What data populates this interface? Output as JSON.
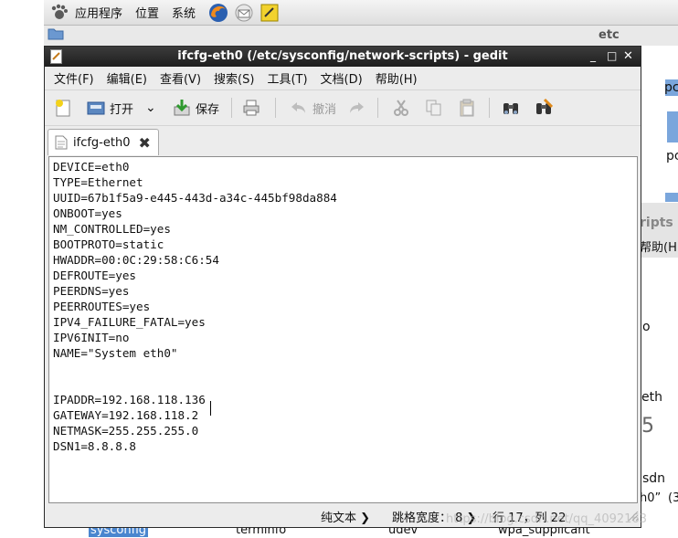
{
  "panel": {
    "menus": [
      "应用程序",
      "位置",
      "系统"
    ],
    "icons": [
      "gnome-foot-icon",
      "firefox-icon",
      "mail-icon",
      "notes-icon"
    ]
  },
  "background_window": {
    "title": "etc",
    "side_labels": [
      "pc",
      "pc",
      "ripts",
      "帮助(H",
      "o",
      "eth",
      "sdn",
      "h0”",
      "(3"
    ],
    "bottom_files": [
      "sysconfig",
      "terminfo",
      "udev",
      "wpa_supplicant"
    ],
    "watermark": "https://blog.csdn.net/qq_4092163"
  },
  "gedit": {
    "title": "ifcfg-eth0 (/etc/sysconfig/network-scripts) - gedit",
    "menus": [
      "文件(F)",
      "编辑(E)",
      "查看(V)",
      "搜索(S)",
      "工具(T)",
      "文档(D)",
      "帮助(H)"
    ],
    "toolbar": {
      "open": "打开",
      "save": "保存",
      "undo": "撤消"
    },
    "tab_name": "ifcfg-eth0",
    "content": "DEVICE=eth0\nTYPE=Ethernet\nUUID=67b1f5a9-e445-443d-a34c-445bf98da884\nONBOOT=yes\nNM_CONTROLLED=yes\nBOOTPROTO=static\nHWADDR=00:0C:29:58:C6:54\nDEFROUTE=yes\nPEERDNS=yes\nPEERROUTES=yes\nIPV4_FAILURE_FATAL=yes\nIPV6INIT=no\nNAME=\"System eth0\"\n\n\nIPADDR=192.168.118.136\nGATEWAY=192.168.118.2\nNETMASK=255.255.255.0\nDSN1=8.8.8.8",
    "status": {
      "mode": "纯文本 ❯",
      "tab_width": "跳格宽度： 8 ❯",
      "position": "行 17，列 22"
    }
  },
  "colors": {
    "titlebar": "#2a2a2a",
    "selection": "#4a86cf"
  }
}
